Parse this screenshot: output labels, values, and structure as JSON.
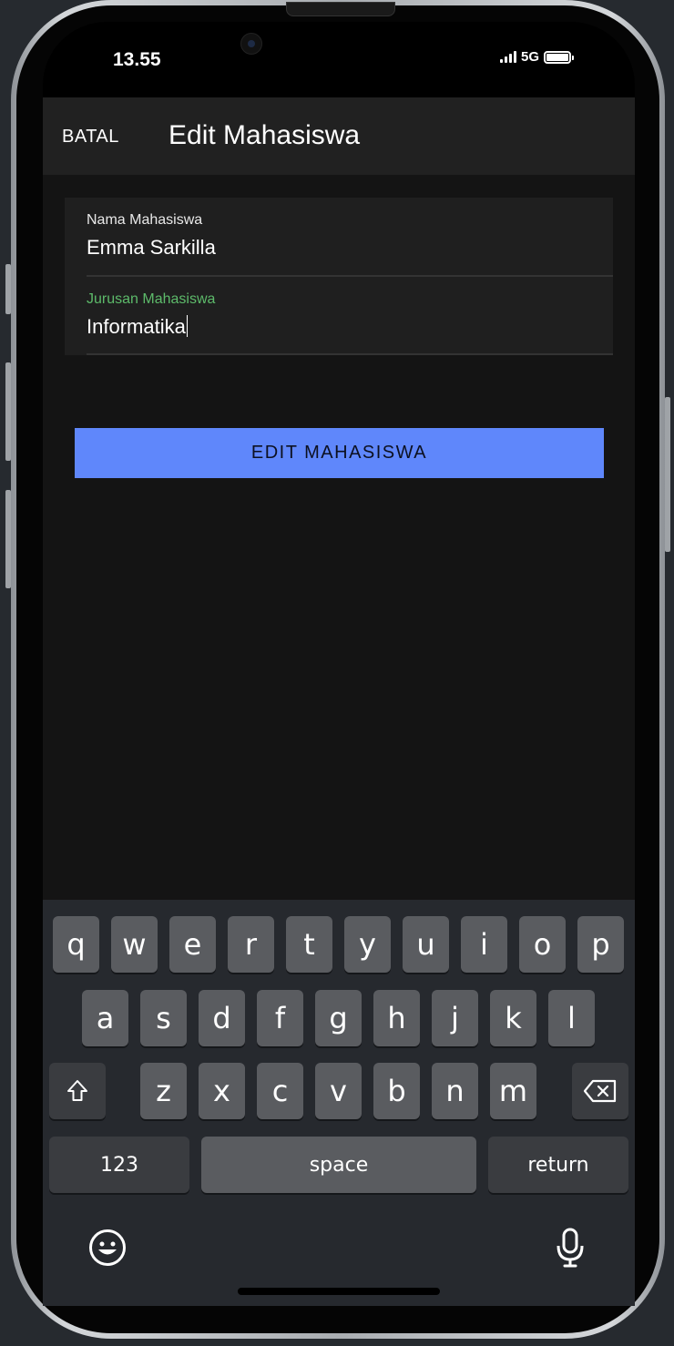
{
  "status_bar": {
    "time": "13.55",
    "network": "5G"
  },
  "header": {
    "cancel_label": "BATAL",
    "title": "Edit Mahasiswa"
  },
  "form": {
    "name_field": {
      "label": "Nama Mahasiswa",
      "value": "Emma Sarkilla"
    },
    "major_field": {
      "label": "Jurusan Mahasiswa",
      "value": "Informatika",
      "focused": true
    }
  },
  "submit_button": {
    "label": "EDIT MAHASISWA"
  },
  "keyboard": {
    "row1": [
      "q",
      "w",
      "e",
      "r",
      "t",
      "y",
      "u",
      "i",
      "o",
      "p"
    ],
    "row2": [
      "a",
      "s",
      "d",
      "f",
      "g",
      "h",
      "j",
      "k",
      "l"
    ],
    "row3": [
      "z",
      "x",
      "c",
      "v",
      "b",
      "n",
      "m"
    ],
    "numbers_key": "123",
    "space_key": "space",
    "return_key": "return"
  },
  "colors": {
    "accent_button": "#5f87fb",
    "focused_label": "#5dba6a",
    "app_background": "#141414",
    "header_background": "#212121"
  },
  "icons": [
    "shift-icon",
    "backspace-icon",
    "emoji-icon",
    "microphone-icon",
    "signal-icon",
    "battery-icon"
  ]
}
